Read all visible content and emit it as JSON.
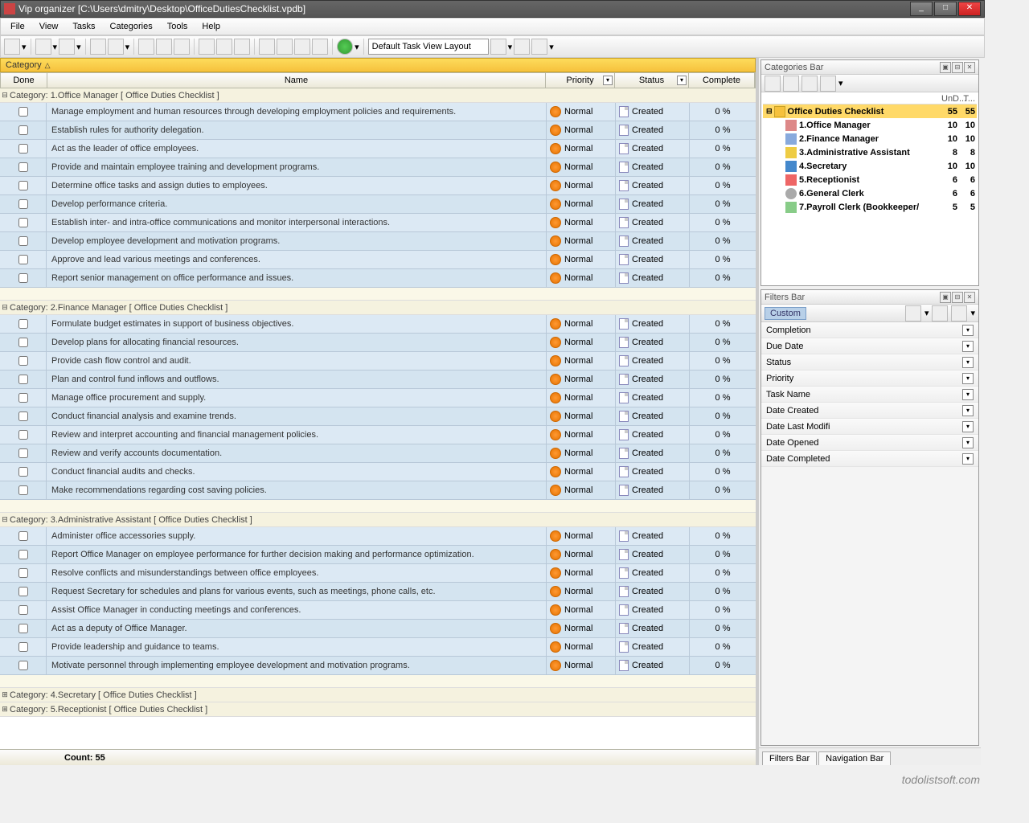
{
  "window": {
    "title": "Vip organizer [C:\\Users\\dmitry\\Desktop\\OfficeDutiesChecklist.vpdb]"
  },
  "menu": [
    "File",
    "View",
    "Tasks",
    "Categories",
    "Tools",
    "Help"
  ],
  "layoutBox": "Default Task View Layout",
  "groupHeader": "Category",
  "columns": {
    "done": "Done",
    "name": "Name",
    "priority": "Priority",
    "status": "Status",
    "complete": "Complete"
  },
  "priorityLabel": "Normal",
  "statusLabel": "Created",
  "completeLabel": "0 %",
  "groups": [
    {
      "title": "Category: 1.Office Manager    [ Office Duties Checklist ]",
      "tasks": [
        "Manage employment and human resources through developing employment policies and requirements.",
        "Establish rules for authority delegation.",
        "Act as the leader of office employees.",
        "Provide and maintain employee training and development programs.",
        "Determine office tasks and assign duties to employees.",
        "Develop performance criteria.",
        "Establish inter- and intra-office communications and monitor interpersonal interactions.",
        "Develop employee development and motivation programs.",
        "Approve and lead various meetings and conferences.",
        "Report senior management on office performance and issues."
      ]
    },
    {
      "title": "Category: 2.Finance Manager    [ Office Duties Checklist ]",
      "tasks": [
        "Formulate budget estimates in support of business objectives.",
        "Develop plans for allocating financial resources.",
        "Provide cash flow control and audit.",
        "Plan and control fund inflows and outflows.",
        "Manage office procurement and supply.",
        "Conduct financial analysis and examine trends.",
        "Review and interpret accounting and financial management policies.",
        "Review and verify accounts documentation.",
        "Conduct financial audits and checks.",
        "Make recommendations regarding cost saving policies."
      ]
    },
    {
      "title": "Category: 3.Administrative Assistant    [ Office Duties Checklist ]",
      "tasks": [
        "Administer office accessories supply.",
        "Report Office Manager on employee performance for further decision making and performance optimization.",
        "Resolve conflicts and misunderstandings between office employees.",
        "Request Secretary for schedules and plans for various events, such as meetings, phone calls, etc.",
        "Assist Office Manager in conducting meetings and conferences.",
        "Act as a deputy of Office Manager.",
        "Provide leadership and guidance to teams.",
        "Motivate personnel through implementing employee development and motivation programs."
      ]
    }
  ],
  "collapsedGroups": [
    "Category: 4.Secretary    [ Office Duties Checklist ]",
    "Category: 5.Receptionist    [ Office Duties Checklist ]"
  ],
  "footer": {
    "count": "Count:  55"
  },
  "categoriesBar": {
    "title": "Categories Bar",
    "headers": {
      "c1": "UnD...",
      "c2": "T..."
    },
    "root": {
      "label": "Office Duties Checklist",
      "n1": "55",
      "n2": "55"
    },
    "items": [
      {
        "icon": "ic-people",
        "label": "1.Office Manager",
        "n1": "10",
        "n2": "10",
        "bold": true
      },
      {
        "icon": "ic-calc",
        "label": "2.Finance Manager",
        "n1": "10",
        "n2": "10",
        "bold": true
      },
      {
        "icon": "ic-key",
        "label": "3.Administrative Assistant",
        "n1": "8",
        "n2": "8",
        "bold": true
      },
      {
        "icon": "ic-flag",
        "label": "4.Secretary",
        "n1": "10",
        "n2": "10",
        "bold": true
      },
      {
        "icon": "ic-star",
        "label": "5.Receptionist",
        "n1": "6",
        "n2": "6",
        "bold": true
      },
      {
        "icon": "ic-clock",
        "label": "6.General Clerk",
        "n1": "6",
        "n2": "6",
        "bold": true
      },
      {
        "icon": "ic-result",
        "label": "7.Payroll Clerk (Bookkeeper/",
        "n1": "5",
        "n2": "5",
        "bold": true
      }
    ]
  },
  "filtersBar": {
    "title": "Filters Bar",
    "custom": "Custom",
    "items": [
      "Completion",
      "Due Date",
      "Status",
      "Priority",
      "Task Name",
      "Date Created",
      "Date Last Modifi",
      "Date Opened",
      "Date Completed"
    ]
  },
  "bottomTabs": [
    "Filters Bar",
    "Navigation Bar"
  ],
  "watermark": "todolistsoft.com"
}
